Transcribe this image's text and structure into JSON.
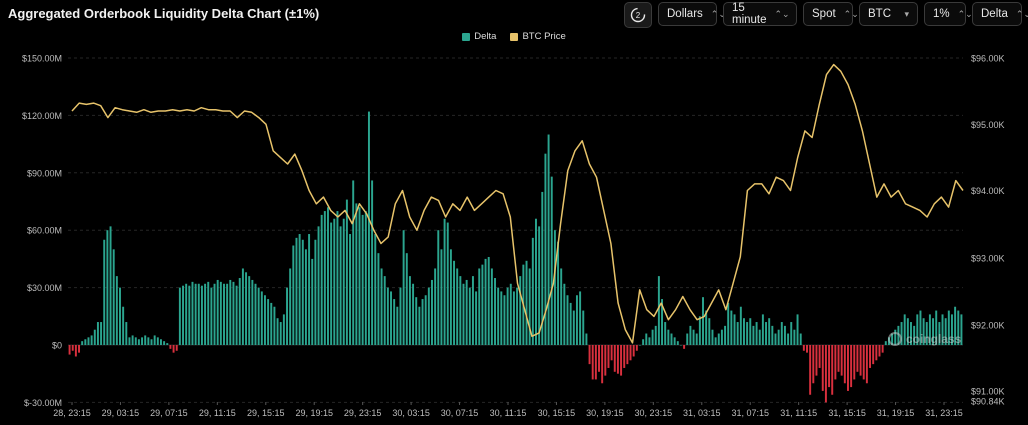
{
  "title": "Aggregated Orderbook Liquidity Delta Chart (±1%)",
  "toolbar": {
    "refresh_icon": "refresh-icon",
    "currency": "Dollars",
    "interval": "15 minute",
    "market": "Spot",
    "coin": "BTC",
    "range": "1%",
    "metric": "Delta"
  },
  "watermark": "coinglass",
  "colors": {
    "positive": "#2ba58f",
    "negative": "#d9303e",
    "price": "#e7c36a",
    "grid": "#262626"
  },
  "chart_data": {
    "type": "bar+line",
    "title": "Aggregated Orderbook Liquidity Delta Chart (±1%)",
    "legend_position": "top-center",
    "grid": true,
    "x_tick_labels": [
      "28, 23:15",
      "29, 03:15",
      "29, 07:15",
      "29, 11:15",
      "29, 15:15",
      "29, 19:15",
      "29, 23:15",
      "30, 03:15",
      "30, 07:15",
      "30, 11:15",
      "30, 15:15",
      "30, 19:15",
      "30, 23:15",
      "31, 03:15",
      "31, 07:15",
      "31, 11:15",
      "31, 15:15",
      "31, 19:15",
      "31, 23:15"
    ],
    "y_left": {
      "ticks": [
        "$150.00M",
        "$120.00M",
        "$90.00M",
        "$60.00M",
        "$30.00M",
        "$0",
        "$-30.00M"
      ],
      "range": [
        -30,
        150
      ],
      "unit": "M USD"
    },
    "y_right": {
      "ticks": [
        "$96.00K",
        "$95.00K",
        "$94.00K",
        "$93.00K",
        "$92.00K",
        "$91.00K",
        "$90.84K"
      ],
      "range": [
        90.84,
        96.0
      ],
      "unit": "K USD"
    },
    "series": [
      {
        "name": "Delta",
        "kind": "bar",
        "unit": "M USD",
        "values": [
          -5,
          -3,
          -6,
          -4,
          2,
          3,
          4,
          5,
          8,
          12,
          12,
          55,
          60,
          62,
          50,
          36,
          30,
          20,
          12,
          4,
          5,
          4,
          3,
          4,
          5,
          4,
          3,
          5,
          4,
          3,
          2,
          1,
          -2,
          -4,
          -3,
          30,
          31,
          32,
          31,
          33,
          32,
          32,
          31,
          32,
          33,
          30,
          32,
          34,
          33,
          32,
          32,
          34,
          33,
          31,
          35,
          40,
          38,
          36,
          34,
          32,
          30,
          28,
          26,
          24,
          22,
          20,
          14,
          12,
          16,
          30,
          40,
          52,
          56,
          58,
          55,
          50,
          58,
          45,
          55,
          62,
          68,
          70,
          72,
          64,
          66,
          70,
          62,
          66,
          76,
          58,
          86,
          74,
          72,
          68,
          70,
          122,
          86,
          58,
          48,
          40,
          36,
          30,
          28,
          24,
          20,
          30,
          60,
          48,
          36,
          32,
          25,
          20,
          24,
          26,
          30,
          34,
          40,
          60,
          50,
          66,
          64,
          50,
          44,
          40,
          36,
          32,
          34,
          30,
          36,
          28,
          40,
          42,
          45,
          46,
          40,
          35,
          30,
          28,
          26,
          30,
          32,
          28,
          30,
          36,
          42,
          44,
          40,
          56,
          66,
          62,
          80,
          100,
          110,
          88,
          60,
          54,
          40,
          32,
          26,
          22,
          18,
          26,
          28,
          18,
          6,
          -10,
          -18,
          -18,
          -14,
          -20,
          -16,
          -12,
          -8,
          -14,
          -15,
          -16,
          -12,
          -10,
          -8,
          -6,
          -3,
          0,
          3,
          6,
          4,
          8,
          10,
          36,
          24,
          12,
          8,
          6,
          4,
          2,
          0,
          -2,
          6,
          10,
          8,
          6,
          15,
          25,
          18,
          14,
          8,
          4,
          6,
          8,
          10,
          22,
          18,
          16,
          12,
          20,
          14,
          12,
          14,
          10,
          12,
          8,
          16,
          12,
          14,
          10,
          6,
          8,
          12,
          10,
          6,
          12,
          8,
          16,
          6,
          -3,
          -4,
          -26,
          -20,
          -16,
          -12,
          -24,
          -30,
          -22,
          -26,
          -18,
          -14,
          -16,
          -20,
          -24,
          -22,
          -18,
          -14,
          -16,
          -18,
          -20,
          -12,
          -10,
          -8,
          -6,
          -4,
          2,
          4,
          6,
          8,
          10,
          12,
          16,
          14,
          12,
          10,
          16,
          18,
          14,
          12,
          16,
          14,
          18,
          12,
          16,
          14,
          18,
          16,
          20,
          18,
          16
        ]
      },
      {
        "name": "BTC Price",
        "kind": "line",
        "unit": "K USD",
        "values": [
          95.2,
          95.32,
          95.3,
          95.32,
          95.28,
          95.1,
          95.25,
          95.22,
          95.2,
          95.18,
          95.22,
          95.18,
          95.2,
          95.2,
          95.22,
          95.2,
          95.22,
          95.2,
          95.25,
          95.22,
          95.22,
          95.2,
          95.2,
          95.1,
          95.2,
          95.18,
          95.1,
          95.0,
          94.6,
          94.5,
          94.4,
          94.55,
          94.3,
          94.0,
          93.8,
          93.9,
          93.7,
          93.6,
          93.7,
          93.5,
          93.8,
          93.65,
          93.4,
          93.2,
          93.3,
          93.8,
          94.0,
          93.6,
          93.4,
          93.7,
          93.9,
          93.85,
          93.6,
          93.8,
          93.7,
          93.9,
          93.7,
          93.8,
          93.9,
          94.0,
          93.95,
          93.6,
          92.6,
          92.2,
          91.8,
          91.85,
          92.2,
          92.6,
          93.5,
          94.3,
          94.6,
          94.75,
          94.4,
          94.2,
          93.7,
          93.2,
          92.3,
          91.9,
          91.7,
          92.5,
          92.2,
          92.1,
          92.3,
          92.05,
          92.2,
          92.4,
          92.2,
          92.05,
          92.1,
          92.3,
          92.5,
          92.2,
          92.6,
          93.0,
          94.0,
          94.1,
          94.1,
          93.95,
          94.2,
          94.15,
          94.0,
          94.5,
          94.9,
          94.8,
          95.3,
          95.75,
          95.9,
          95.8,
          95.6,
          95.3,
          94.9,
          94.4,
          93.9,
          94.1,
          93.9,
          94.0,
          93.8,
          93.75,
          93.7,
          93.6,
          93.8,
          93.9,
          93.75,
          94.15,
          94.0
        ]
      }
    ]
  }
}
